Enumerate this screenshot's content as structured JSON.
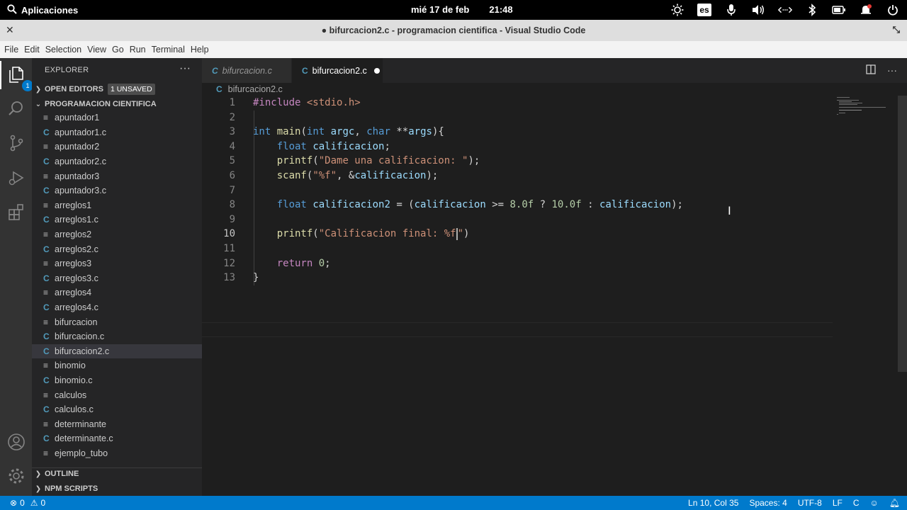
{
  "topbar": {
    "apps_label": "Aplicaciones",
    "date": "mié 17 de feb",
    "time": "21:48",
    "lang": "es"
  },
  "window": {
    "title": "● bifurcacion2.c - programacion cientifica - Visual Studio Code"
  },
  "menu": [
    "File",
    "Edit",
    "Selection",
    "View",
    "Go",
    "Run",
    "Terminal",
    "Help"
  ],
  "activity": {
    "explorer_badge": "1"
  },
  "sidebar": {
    "header": "EXPLORER",
    "open_editors": "OPEN EDITORS",
    "unsaved_badge": "1 UNSAVED",
    "folder": "PROGRAMACION CIENTIFICA",
    "files": [
      {
        "name": "apuntador1",
        "type": "text"
      },
      {
        "name": "apuntador1.c",
        "type": "c"
      },
      {
        "name": "apuntador2",
        "type": "text"
      },
      {
        "name": "apuntador2.c",
        "type": "c"
      },
      {
        "name": "apuntador3",
        "type": "text"
      },
      {
        "name": "apuntador3.c",
        "type": "c"
      },
      {
        "name": "arreglos1",
        "type": "text"
      },
      {
        "name": "arreglos1.c",
        "type": "c"
      },
      {
        "name": "arreglos2",
        "type": "text"
      },
      {
        "name": "arreglos2.c",
        "type": "c"
      },
      {
        "name": "arreglos3",
        "type": "text"
      },
      {
        "name": "arreglos3.c",
        "type": "c"
      },
      {
        "name": "arreglos4",
        "type": "text"
      },
      {
        "name": "arreglos4.c",
        "type": "c"
      },
      {
        "name": "bifurcacion",
        "type": "text"
      },
      {
        "name": "bifurcacion.c",
        "type": "c"
      },
      {
        "name": "bifurcacion2.c",
        "type": "c",
        "selected": true
      },
      {
        "name": "binomio",
        "type": "text"
      },
      {
        "name": "binomio.c",
        "type": "c"
      },
      {
        "name": "calculos",
        "type": "text"
      },
      {
        "name": "calculos.c",
        "type": "c"
      },
      {
        "name": "determinante",
        "type": "text"
      },
      {
        "name": "determinante.c",
        "type": "c"
      },
      {
        "name": "ejemplo_tubo",
        "type": "text"
      }
    ],
    "outline": "OUTLINE",
    "npm": "NPM SCRIPTS"
  },
  "tabs": [
    {
      "label": "bifurcacion.c",
      "active": false
    },
    {
      "label": "bifurcacion2.c",
      "active": true,
      "dirty": true
    }
  ],
  "breadcrumb": "bifurcacion2.c",
  "code": {
    "current_line": 10,
    "lines": [
      "#include <stdio.h>",
      "",
      "int main(int argc, char **args){",
      "    float calificacion;",
      "    printf(\"Dame una calificacion: \");",
      "    scanf(\"%f\", &calificacion);",
      "",
      "    float calificacion2 = (calificacion >= 8.0f ? 10.0f : calificacion);",
      "",
      "    printf(\"Calificacion final: %f\")",
      "",
      "    return 0;",
      "}"
    ]
  },
  "status": {
    "errors": "0",
    "warnings": "0",
    "position": "Ln 10, Col 35",
    "spaces": "Spaces: 4",
    "encoding": "UTF-8",
    "eol": "LF",
    "language": "C"
  },
  "colors": {
    "accent": "#007acc",
    "keyword": "#569cd6",
    "string": "#ce9178",
    "function": "#dcdcaa",
    "number": "#b5cea8",
    "variable": "#9cdcfe"
  }
}
